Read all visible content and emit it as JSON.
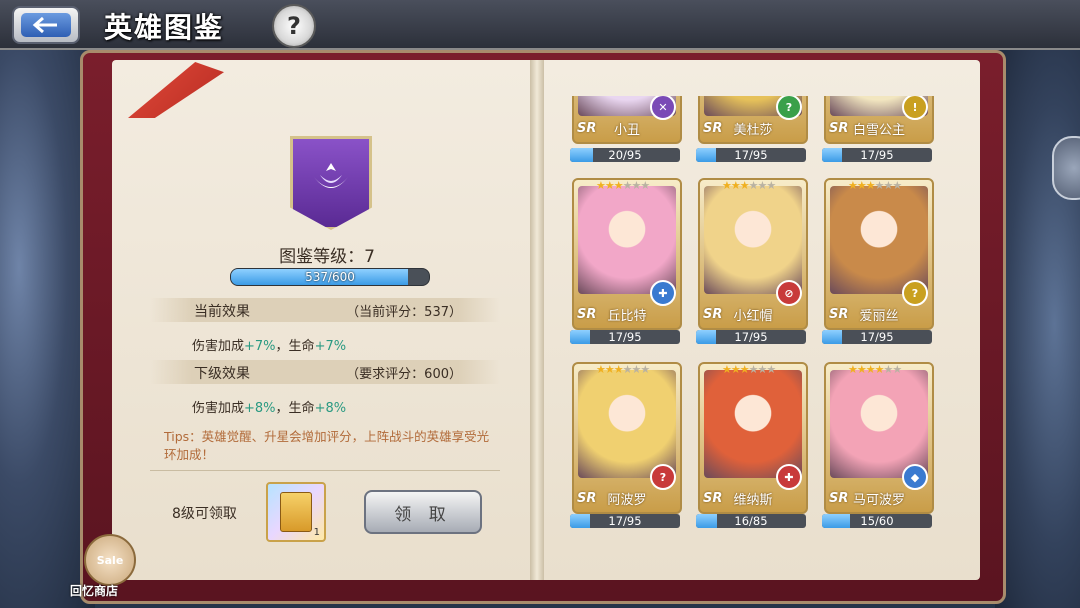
{
  "header": {
    "title": "英雄图鉴",
    "back_icon": "back-arrow-icon",
    "help_label": "?"
  },
  "left": {
    "level_label": "图鉴等级：7",
    "exp": {
      "current": 537,
      "max": 600,
      "text": "537/600"
    },
    "current_effect": {
      "title": "当前效果",
      "score": "（当前评分：537）",
      "damage_label": "伤害加成",
      "damage": "+7%",
      "hp_label": "，生命",
      "hp": "+7%"
    },
    "next_effect": {
      "title": "下级效果",
      "score": "（要求评分：600）",
      "damage_label": "伤害加成",
      "damage": "+8%",
      "hp_label": "，生命",
      "hp": "+8%"
    },
    "tips": "Tips：英雄觉醒、升星会增加评分，上阵战斗的英雄享受光环加成！",
    "reward_label": "8级可领取",
    "reward_count": "1",
    "claim_label": "领 取"
  },
  "sale": {
    "badge": "Sale",
    "label": "回忆商店"
  },
  "heroes": [
    {
      "name": "小丑",
      "rarity": "SR",
      "stars": 0,
      "progress": 20,
      "max": 95,
      "progress_text": "20/95",
      "role": "sword",
      "role_color": "#7a4ab6"
    },
    {
      "name": "美杜莎",
      "rarity": "SR",
      "stars": 0,
      "progress": 17,
      "max": 95,
      "progress_text": "17/95",
      "role": "question",
      "role_color": "#3aa04a"
    },
    {
      "name": "白雪公主",
      "rarity": "SR",
      "stars": 0,
      "progress": 17,
      "max": 95,
      "progress_text": "17/95",
      "role": "exclaim",
      "role_color": "#c9a020"
    },
    {
      "name": "丘比特",
      "rarity": "SR",
      "stars": 3,
      "progress": 17,
      "max": 95,
      "progress_text": "17/95",
      "role": "cross",
      "role_color": "#3a7ad0"
    },
    {
      "name": "小红帽",
      "rarity": "SR",
      "stars": 3,
      "progress": 17,
      "max": 95,
      "progress_text": "17/95",
      "role": "slash",
      "role_color": "#c83a3a"
    },
    {
      "name": "爱丽丝",
      "rarity": "SR",
      "stars": 3,
      "progress": 17,
      "max": 95,
      "progress_text": "17/95",
      "role": "question",
      "role_color": "#c9a020"
    },
    {
      "name": "阿波罗",
      "rarity": "SR",
      "stars": 3,
      "progress": 17,
      "max": 95,
      "progress_text": "17/95",
      "role": "question",
      "role_color": "#c83a3a"
    },
    {
      "name": "维纳斯",
      "rarity": "SR",
      "stars": 3,
      "progress": 16,
      "max": 85,
      "progress_text": "16/85",
      "role": "cross",
      "role_color": "#c83a3a"
    },
    {
      "name": "马可波罗",
      "rarity": "SR",
      "stars": 4,
      "progress": 15,
      "max": 60,
      "progress_text": "15/60",
      "role": "shield",
      "role_color": "#3a7ad0"
    }
  ]
}
